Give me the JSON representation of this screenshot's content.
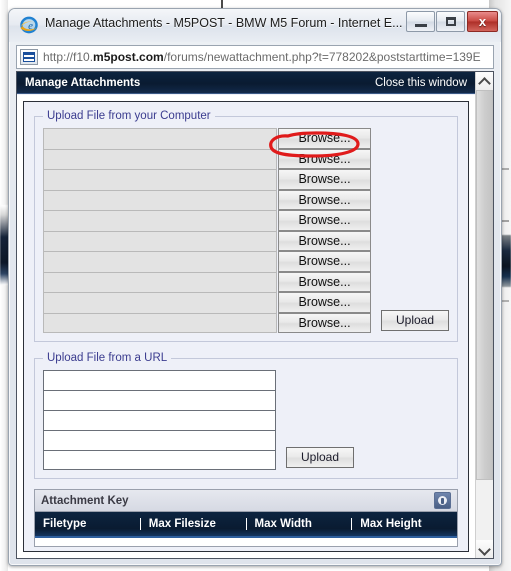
{
  "browser": {
    "title": "Manage Attachments - M5POST - BMW M5 Forum - Internet E...",
    "icon": "internet-explorer-icon",
    "minimize_label": "",
    "maximize_label": "",
    "close_label": "x",
    "address": {
      "prefix": "http://f10.",
      "domain": "m5post.com",
      "suffix": "/forums/newattachment.php?t=778202&poststarttime=139E",
      "icon": "page-icon"
    }
  },
  "dialog": {
    "header_title": "Manage Attachments",
    "close_link": "Close this window"
  },
  "upload_from_computer": {
    "legend": "Upload File from your Computer",
    "rows": [
      {
        "value": "",
        "browse_label": "Browse..."
      },
      {
        "value": "",
        "browse_label": "Browse..."
      },
      {
        "value": "",
        "browse_label": "Browse..."
      },
      {
        "value": "",
        "browse_label": "Browse..."
      },
      {
        "value": "",
        "browse_label": "Browse..."
      },
      {
        "value": "",
        "browse_label": "Browse..."
      },
      {
        "value": "",
        "browse_label": "Browse..."
      },
      {
        "value": "",
        "browse_label": "Browse..."
      },
      {
        "value": "",
        "browse_label": "Browse..."
      },
      {
        "value": "",
        "browse_label": "Browse..."
      }
    ],
    "upload_label": "Upload"
  },
  "upload_from_url": {
    "legend": "Upload File from a URL",
    "rows": [
      {
        "value": ""
      },
      {
        "value": ""
      },
      {
        "value": ""
      },
      {
        "value": ""
      },
      {
        "value": ""
      }
    ],
    "upload_label": "Upload"
  },
  "attachment_key": {
    "title": "Attachment Key",
    "collapse_icon": "collapse-expand-icon",
    "columns": [
      "Filetype",
      "Max Filesize",
      "Max Width",
      "Max Height"
    ]
  },
  "scrollbar": {
    "up_icon": "chevron-up-icon",
    "down_icon": "chevron-down-icon"
  },
  "annotation": {
    "shape": "red-ellipse-highlight",
    "color": "#e01b1b",
    "target": "first-browse-button"
  }
}
